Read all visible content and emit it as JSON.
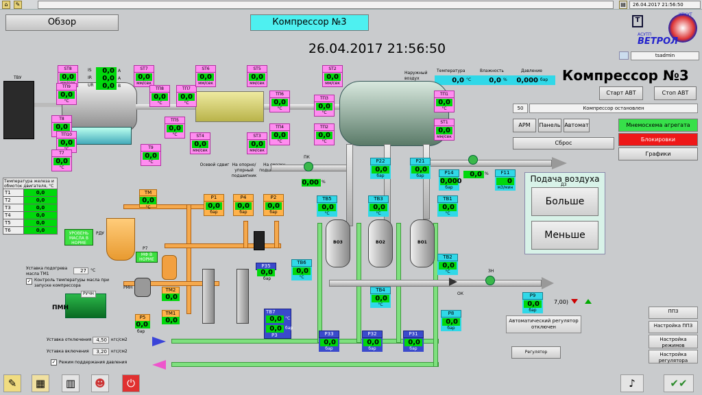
{
  "header": {
    "datetime_small": "26.04.2017 21:56:50",
    "datetime": "26.04.2017 21:56:50",
    "overview_label": "Обзор",
    "active_tab": "Компрессор №3",
    "title": "Компрессор №3",
    "user": "tsadmin"
  },
  "logo": {
    "brand": "ВЕТРОЛ",
    "sub1": "АСУТП",
    "sub2": "ИРКУТ"
  },
  "ambient": {
    "outside_label": "Наружный воздух",
    "temp_label": "Температура",
    "temp_value": "0,0",
    "temp_unit": "°C",
    "hum_label": "Влажность",
    "hum_value": "0,0",
    "hum_unit": "%",
    "press_label": "Давление",
    "press_value": "0,000",
    "press_unit": "бар"
  },
  "controls": {
    "start": "Старт АВТ",
    "stop": "Стоп АВТ",
    "status_code": "50",
    "status_text": "Компрессор остановлен",
    "arm": "АРМ",
    "panel": "Панель",
    "auto": "Автомат",
    "reset": "Сброс",
    "mnemo": "Мнемосхема агрегата",
    "blocks": "Блокировки",
    "graphs": "Графики"
  },
  "air_supply": {
    "title": "Подача воздуха",
    "more": "Больше",
    "less": "Меньше",
    "d3": "Д3"
  },
  "side_buttons": {
    "ppz": "ППЗ",
    "ppz_settings": "Настройка ППЗ",
    "modes": "Настройка режимов",
    "regulator": "Настройка регулятора"
  },
  "regulator": {
    "status": "Автоматический регулятор отключен",
    "button": "Регулятор",
    "setpoint": "7,00)"
  },
  "motor": {
    "tvu": "ТВУ",
    "is": "IS",
    "ir": "IR",
    "ur": "UR",
    "is_val": "0,0",
    "ir_val": "0,0",
    "ur_val": "0,0",
    "unit_a": "А",
    "unit_v": "В"
  },
  "sensors": [
    {
      "id": "ST8",
      "val": "0,0",
      "unit": "мм/сек"
    },
    {
      "id": "ТП9",
      "val": "0,0",
      "unit": "°C"
    },
    {
      "id": "T8",
      "val": "0,0",
      "unit": "°C"
    },
    {
      "id": "ТП10",
      "val": "0,0",
      "unit": "°C"
    },
    {
      "id": "T7",
      "val": "0,0",
      "unit": "°C"
    },
    {
      "id": "T9",
      "val": "0,0",
      "unit": "°C"
    },
    {
      "id": "ST7",
      "val": "0,0",
      "unit": "мм/сек"
    },
    {
      "id": "ТП8",
      "val": "0,0",
      "unit": "°C"
    },
    {
      "id": "ТП7",
      "val": "0,0",
      "unit": "°C"
    },
    {
      "id": "ТП5",
      "val": "0,0",
      "unit": "°C"
    },
    {
      "id": "ST6",
      "val": "0,0",
      "unit": "мм/сек"
    },
    {
      "id": "ST4",
      "val": "0,0",
      "unit": "мм/сек"
    },
    {
      "id": "ST5",
      "val": "0,0",
      "unit": "мм/сек"
    },
    {
      "id": "ТП6",
      "val": "0,0",
      "unit": "°C"
    },
    {
      "id": "ТП4",
      "val": "0,0",
      "unit": "°C"
    },
    {
      "id": "ST3",
      "val": "0,0",
      "unit": "мм/сек"
    },
    {
      "id": "ST2",
      "val": "0,0",
      "unit": "мм/сек"
    },
    {
      "id": "ТП3",
      "val": "0,0",
      "unit": "°C"
    },
    {
      "id": "ТП2",
      "val": "0,0",
      "unit": "°C"
    },
    {
      "id": "ТП1",
      "val": "0,0",
      "unit": "°C"
    },
    {
      "id": "ST1",
      "val": "0,0",
      "unit": "мм/сек"
    }
  ],
  "windings": {
    "title": "Температура железа и обмоток двигателя, °C",
    "rows": [
      {
        "id": "T1",
        "val": "0,0"
      },
      {
        "id": "T2",
        "val": "0,0"
      },
      {
        "id": "T3",
        "val": "0,0"
      },
      {
        "id": "T4",
        "val": "0,0"
      },
      {
        "id": "T5",
        "val": "0,0"
      },
      {
        "id": "T6",
        "val": "0,0"
      }
    ]
  },
  "oil": {
    "tm_id": "ТМ",
    "tm_val": "0,0",
    "tm_unit": "°C",
    "level": "УРОВЕНЬ МАСЛА В НОРМЕ",
    "rdu": "РДУ",
    "p7": "Р7",
    "mf": "МФ В НОРМЕ",
    "rmn": "РМН",
    "pmn": "ПМН",
    "ruchn": "РУЧН",
    "heat_label": "Уставка подогрева масла ТМ1",
    "heat_val": "27",
    "heat_unit": "°C",
    "check1": "Контроль температуры масла при запуске компрессора",
    "tm2": "ТМ2",
    "tm2_val": "0,0",
    "tm1": "ТМ1",
    "tm1_val": "0,0",
    "p5": "Р5",
    "p5_val": "0,0",
    "p5_unit": "бар",
    "off_label": "Уставка отключения",
    "off_val": "4,50",
    "off_unit": "кгс/см2",
    "on_label": "Уставка включения",
    "on_val": "3,20",
    "on_unit": "кгс/см2",
    "check2": "Режим поддержания давления"
  },
  "pressures": [
    {
      "id": "Р1",
      "val": "0,0",
      "unit": "бар",
      "note": "Осевой сдвиг"
    },
    {
      "id": "Р4",
      "val": "0,0",
      "unit": "бар",
      "note": "На опорно/ упорный подшипник"
    },
    {
      "id": "Р2",
      "val": "0,0",
      "unit": "бар",
      "note": "На смазку подшипников"
    }
  ],
  "p35": {
    "id": "Р35",
    "val": "0,0",
    "unit": "бар"
  },
  "tb7": {
    "id": "ТВ7",
    "val": "0,0",
    "unit": "°C",
    "p3": "Р3",
    "p3_val": "0,0",
    "p3_unit": "бар"
  },
  "air": {
    "pk": "ПК",
    "pk_val": "0,00",
    "pk_unit": "%",
    "p22": "Р22",
    "p22_val": "0,0",
    "p21": "Р21",
    "p21_val": "0,0",
    "p14": "Р14",
    "p14_val": "0,000",
    "d3_val": "0,0",
    "d3_unit": "%",
    "f11": "F11",
    "f11_val": "0",
    "f11_unit": "м3/мин",
    "tb5": "ТВ5",
    "tb5_val": "0,0",
    "tb3": "ТВ3",
    "tb3_val": "0,0",
    "tb1": "ТВ1",
    "tb1_val": "0,0",
    "vo3": "ВО3",
    "vo2": "ВО2",
    "vo1": "ВО1",
    "tb6": "ТВ6",
    "tb6_val": "0,0",
    "tb4": "ТВ4",
    "tb4_val": "0,0",
    "tb2": "ТВ2",
    "tb2_val": "0,0",
    "ok": "ОК",
    "zn": "ЗН",
    "p9": "Р9",
    "p9_val": "0,0",
    "p8": "Р8",
    "p8_val": "0,0",
    "p33": "Р33",
    "p33_val": "0,0",
    "p32": "Р32",
    "p32_val": "0,0",
    "p31": "Р31",
    "p31_val": "0,0",
    "unit_bar": "бар",
    "unit_c": "°C"
  },
  "colors": {
    "green": "#00d80c",
    "pink": "#ff8cf0",
    "orange": "#ffb24a",
    "blue": "#3a4acc",
    "cyan": "#30d8e8"
  }
}
